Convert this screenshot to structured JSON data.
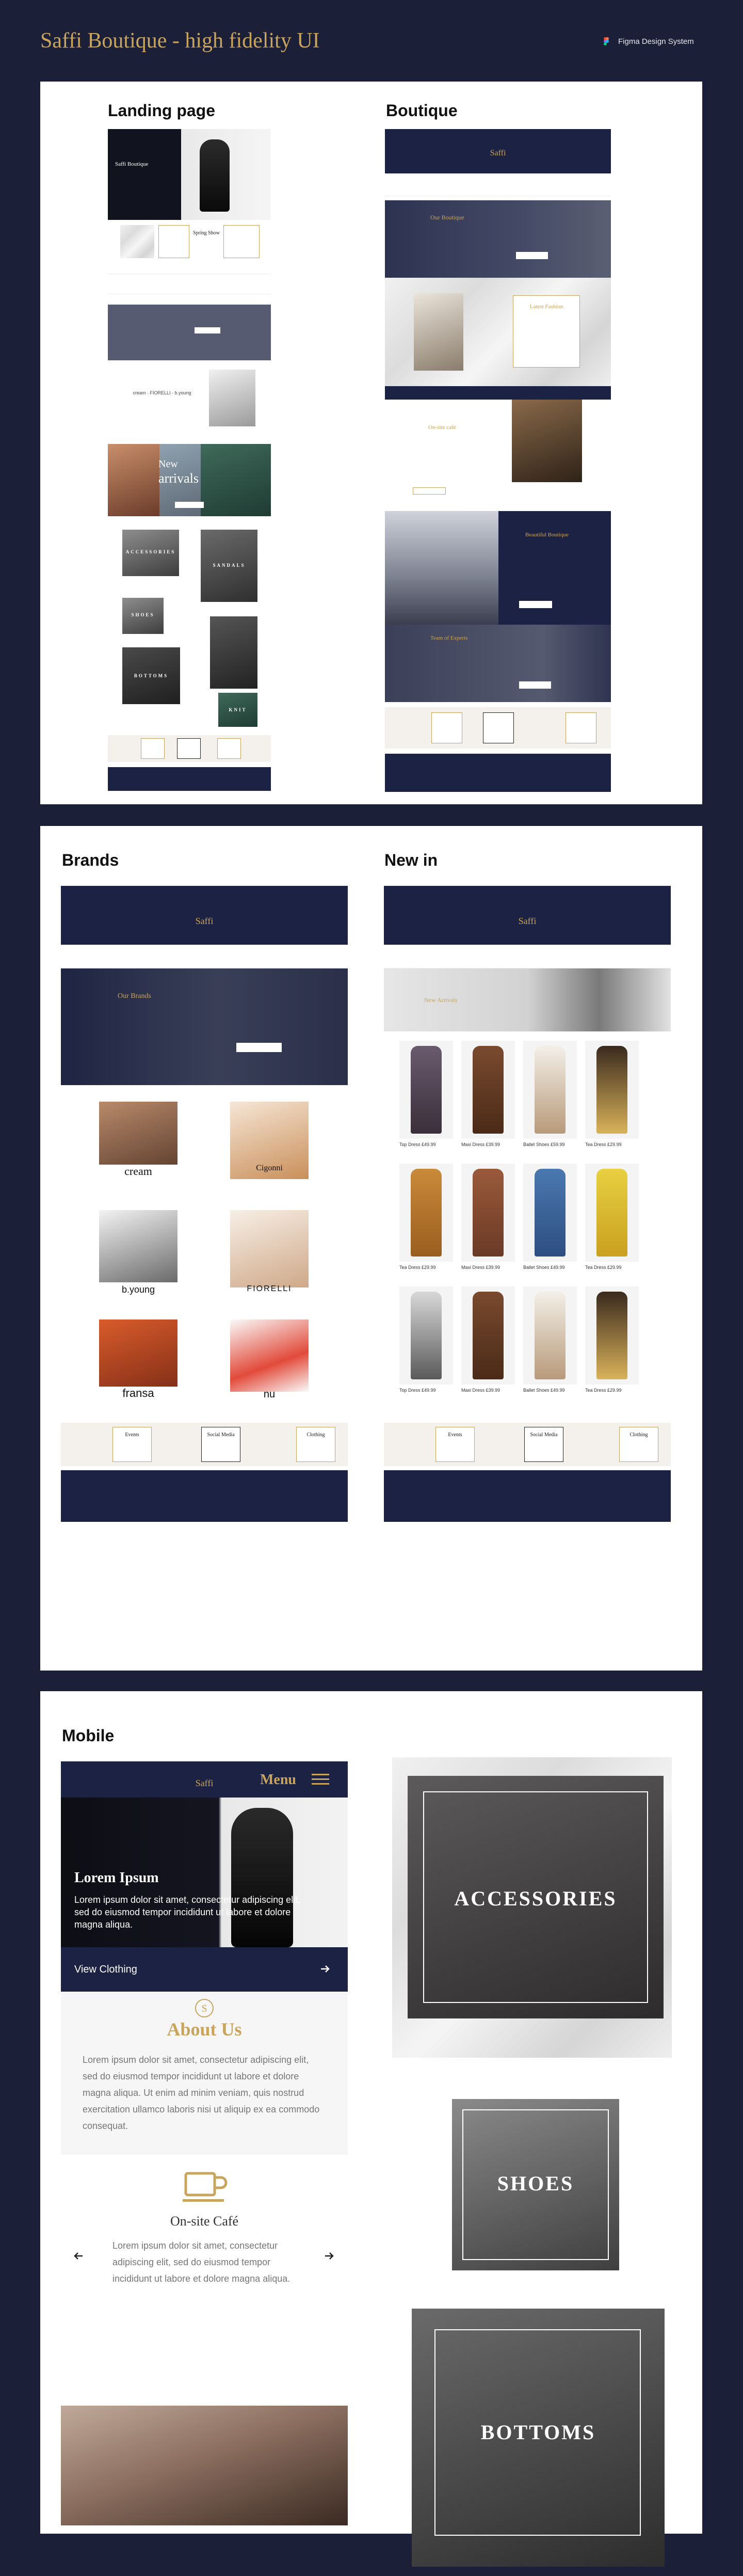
{
  "header": {
    "title": "Saffi Boutique - high fidelity UI",
    "design_system_label": "Figma Design System"
  },
  "sections": {
    "landing": "Landing page",
    "boutique": "Boutique",
    "brands": "Brands",
    "new_in": "New in",
    "mobile": "Mobile"
  },
  "logo_text": "Saffi",
  "landing": {
    "hero_title": "Saffi Boutique",
    "new_arrivals_title": "New",
    "new_arrivals_sub": "arrivals",
    "categories": [
      "ACCESSORIES",
      "SANDALS",
      "SHOES",
      "BOTTOMS",
      "KNIT"
    ],
    "promo_title": "Spring Show"
  },
  "boutique": {
    "about_title": "Our Boutique",
    "latest_fashion": "Latest Fashion",
    "cafe_title": "On-site café",
    "beautiful_title": "Beautiful Boutique",
    "team_title": "Team of Experts"
  },
  "brands_page": {
    "hero_title": "Our Brands",
    "list": [
      "cream",
      "Cigonni",
      "b.young",
      "FIORELLI",
      "fransa",
      "nu"
    ]
  },
  "newin_page": {
    "hero_title": "New Arrivals",
    "prices": [
      "Top Dress £49.99",
      "Maxi Dress £39.99",
      "Ballet Shoes £59.99",
      "Tea Dress £29.99",
      "Tea Dress £29.99",
      "Maxi Dress £39.99",
      "Ballet Shoes £49.99",
      "Tea Dress £29.99",
      "Top Dress £49.99",
      "Maxi Dress £39.99",
      "Ballet Shoes £49.99",
      "Tea Dress £29.99"
    ]
  },
  "promo_strip": {
    "events": "Events",
    "social": "Social Media",
    "clothing": "Clothing"
  },
  "mobile": {
    "menu_label": "Menu",
    "hero_title": "Lorem Ipsum",
    "hero_text": "Lorem ipsum dolor sit amet, consectetur adipiscing elit, sed do eiusmod tempor incididunt ut labore et dolore magna aliqua.",
    "view_clothing": "View Clothing",
    "about_title": "About Us",
    "about_text": "Lorem ipsum dolor sit amet, consectetur adipiscing elit, sed do eiusmod tempor incididunt ut labore et dolore magna aliqua. Ut enim ad minim veniam, quis nostrud exercitation ullamco laboris nisi ut aliquip ex ea commodo consequat.",
    "cafe_title": "On-site Café",
    "cafe_text": "Lorem ipsum dolor sit amet, consectetur adipiscing elit, sed do eiusmod tempor incididunt ut labore et dolore magna aliqua.",
    "tile_accessories": "ACCESSORIES",
    "tile_shoes": "SHOES",
    "tile_bottoms": "BOTTOMS"
  },
  "colors": {
    "navy": "#1c2243",
    "background": "#1b1f38",
    "gold": "#c9a45c"
  }
}
